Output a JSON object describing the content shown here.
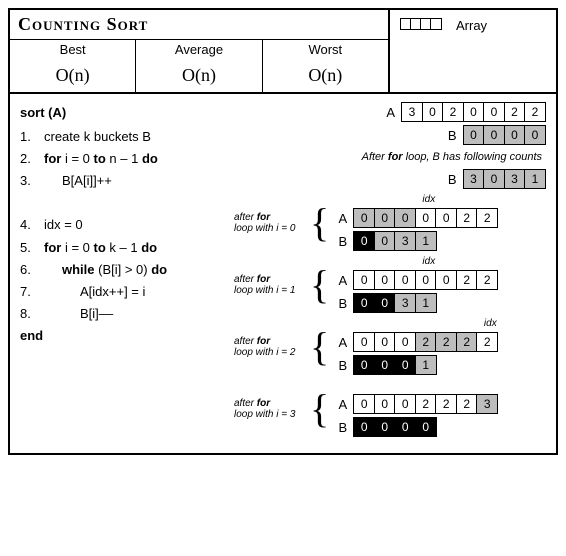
{
  "title": "Counting Sort",
  "complexity": {
    "headers": [
      "Best",
      "Average",
      "Worst"
    ],
    "values": [
      "O(n)",
      "O(n)",
      "O(n)"
    ]
  },
  "legend": {
    "label": "Array"
  },
  "pseudocode": {
    "signature": "sort (A)",
    "lines": [
      {
        "n": "1.",
        "indent": 0,
        "parts": [
          "create k buckets B"
        ]
      },
      {
        "n": "2.",
        "indent": 0,
        "parts": [
          [
            "kw",
            "for"
          ],
          [
            "t",
            " i = 0 "
          ],
          [
            "kw",
            "to"
          ],
          [
            "t",
            " n – 1 "
          ],
          [
            "kw",
            "do"
          ]
        ]
      },
      {
        "n": "3.",
        "indent": 1,
        "parts": [
          "B[A[i]]++"
        ]
      },
      {
        "n": "",
        "indent": 0,
        "parts": []
      },
      {
        "n": "4.",
        "indent": 0,
        "parts": [
          "idx = 0"
        ]
      },
      {
        "n": "5.",
        "indent": 0,
        "parts": [
          [
            "kw",
            "for"
          ],
          [
            "t",
            " i = 0 "
          ],
          [
            "kw",
            "to"
          ],
          [
            "t",
            " k – 1 "
          ],
          [
            "kw",
            "do"
          ]
        ]
      },
      {
        "n": "6.",
        "indent": 1,
        "parts": [
          [
            "kw",
            "while"
          ],
          [
            "t",
            " (B[i] > 0) "
          ],
          [
            "kw",
            "do"
          ]
        ]
      },
      {
        "n": "7.",
        "indent": 2,
        "parts": [
          "A[idx++] = i"
        ]
      },
      {
        "n": "8.",
        "indent": 2,
        "parts": [
          "B[i]––"
        ]
      }
    ],
    "end": "end"
  },
  "initial": {
    "A": {
      "cells": [
        [
          "w",
          "3"
        ],
        [
          "w",
          "0"
        ],
        [
          "w",
          "2"
        ],
        [
          "w",
          "0"
        ],
        [
          "w",
          "0"
        ],
        [
          "w",
          "2"
        ],
        [
          "w",
          "2"
        ]
      ]
    },
    "B": {
      "cells": [
        [
          "g",
          "0"
        ],
        [
          "g",
          "0"
        ],
        [
          "g",
          "0"
        ],
        [
          "g",
          "0"
        ]
      ]
    }
  },
  "after_first_for_note": "After for loop, B has following counts",
  "after_first_for": {
    "B": {
      "cells": [
        [
          "g",
          "3"
        ],
        [
          "g",
          "0"
        ],
        [
          "g",
          "3"
        ],
        [
          "g",
          "1"
        ]
      ]
    }
  },
  "iterations": [
    {
      "caption_before": "after for",
      "caption": "loop with i = 0",
      "idx_col_ref": 3,
      "A": {
        "cells": [
          [
            "g",
            "0"
          ],
          [
            "g",
            "0"
          ],
          [
            "g",
            "0"
          ],
          [
            "w",
            "0"
          ],
          [
            "w",
            "0"
          ],
          [
            "w",
            "2"
          ],
          [
            "w",
            "2"
          ]
        ]
      },
      "B": {
        "cells": [
          [
            "b",
            "0"
          ],
          [
            "g",
            "0"
          ],
          [
            "g",
            "3"
          ],
          [
            "g",
            "1"
          ]
        ]
      }
    },
    {
      "caption_before": "after for",
      "caption": "loop with i = 1",
      "idx_col_ref": 3,
      "A": {
        "cells": [
          [
            "w",
            "0"
          ],
          [
            "w",
            "0"
          ],
          [
            "w",
            "0"
          ],
          [
            "w",
            "0"
          ],
          [
            "w",
            "0"
          ],
          [
            "w",
            "2"
          ],
          [
            "w",
            "2"
          ]
        ]
      },
      "B": {
        "cells": [
          [
            "b",
            "0"
          ],
          [
            "b",
            "0"
          ],
          [
            "g",
            "3"
          ],
          [
            "g",
            "1"
          ]
        ]
      }
    },
    {
      "caption_before": "after for",
      "caption": "loop with i = 2",
      "idx_col_ref": 6,
      "A": {
        "cells": [
          [
            "w",
            "0"
          ],
          [
            "w",
            "0"
          ],
          [
            "w",
            "0"
          ],
          [
            "g",
            "2"
          ],
          [
            "g",
            "2"
          ],
          [
            "g",
            "2"
          ],
          [
            "w",
            "2"
          ]
        ]
      },
      "B": {
        "cells": [
          [
            "b",
            "0"
          ],
          [
            "b",
            "0"
          ],
          [
            "b",
            "0"
          ],
          [
            "g",
            "1"
          ]
        ]
      }
    },
    {
      "caption_before": "after for",
      "caption": "loop with i = 3",
      "idx_col_ref": -1,
      "A": {
        "cells": [
          [
            "w",
            "0"
          ],
          [
            "w",
            "0"
          ],
          [
            "w",
            "0"
          ],
          [
            "w",
            "2"
          ],
          [
            "w",
            "2"
          ],
          [
            "w",
            "2"
          ],
          [
            "g",
            "3"
          ]
        ]
      },
      "B": {
        "cells": [
          [
            "b",
            "0"
          ],
          [
            "b",
            "0"
          ],
          [
            "b",
            "0"
          ],
          [
            "b",
            "0"
          ]
        ]
      }
    }
  ],
  "labels": {
    "A": "A",
    "B": "B",
    "idx": "idx"
  }
}
